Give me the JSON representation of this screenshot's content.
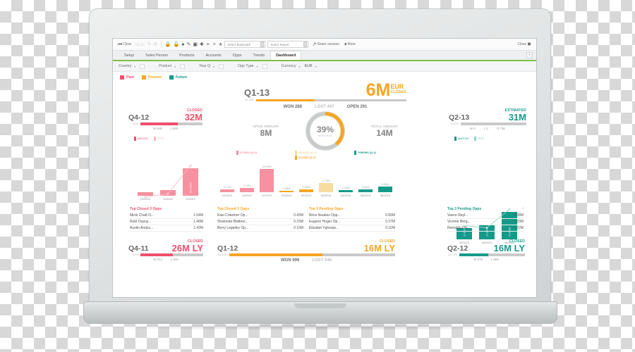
{
  "toolbar": {
    "clear_label": "Clear",
    "back_icon": "back-to-start-icon",
    "prev_icon": "previous-icon",
    "next_icon": "next-icon",
    "undo_icon": "undo-icon",
    "redo_icon": "redo-icon",
    "lock_icon": "lock-icon",
    "unlock_icon": "unlock-icon",
    "clock_icon": "clock-icon",
    "edit_icon": "edit-icon",
    "layout_icon": "layout-icon",
    "add_icon": "add-icon",
    "brush_icon": "brush-icon",
    "star_outline_icon": "star-outline-icon",
    "star_filled_icon": "star-filled-icon",
    "bookmark_field": "Select Bookmark",
    "report_field": "Select Report",
    "share_label": "Share session",
    "share_icon": "share-icon",
    "more_label": "More",
    "more_caret": "▾",
    "close_label": "Close",
    "close_icon": "close-icon"
  },
  "tabs": [
    {
      "label": "Dashboard",
      "active": true
    },
    {
      "label": "Trends",
      "active": false
    },
    {
      "label": "Opps",
      "active": false
    },
    {
      "label": "Accounts",
      "active": false
    },
    {
      "label": "Products",
      "active": false
    },
    {
      "label": "Sales Person",
      "active": false
    },
    {
      "label": "Setup",
      "active": false
    }
  ],
  "tab_add_label": "+",
  "filters": [
    {
      "label": "Country",
      "value": ""
    },
    {
      "label": "Product",
      "value": ""
    },
    {
      "label": "Year Q",
      "value": ""
    },
    {
      "label": "Opp Type",
      "value": ""
    },
    {
      "label": "Currency",
      "value": "EUR"
    }
  ],
  "legend": [
    {
      "label": "Past",
      "color": "#f04f6e"
    },
    {
      "label": "Present",
      "color": "#f5a623"
    },
    {
      "label": "Future",
      "color": "#159a8a"
    }
  ],
  "hero": {
    "period": "Q1-13",
    "value": "6M",
    "currency": "EUR",
    "caption": "CLOSED",
    "pct_label": "39.18%",
    "pct": 39.18,
    "won": "WON 288",
    "lost": "LOST 447",
    "open": "OPEN 291",
    "color": "#f5a623"
  },
  "gauge": {
    "pct_text": "39%",
    "pct": 39,
    "label": "WIN RATE",
    "open_label": "OPEN AMOUNT",
    "open_value": "8M",
    "total_label": "TOTAL AMOUNT",
    "total_value": "14M",
    "color": "#f5a623"
  },
  "columns": [
    {
      "id": "past",
      "color": "#f04f6e",
      "kpi": {
        "caption": "CLOSED",
        "period": "Q4-12",
        "value": "32M",
        "pct_label": "60%",
        "pct": 60,
        "won": "W 849",
        "lost": "L 560"
      },
      "mini_legend": [
        {
          "label": "AMOUNT",
          "color": "#f04f6e"
        },
        {
          "label": "OPPS",
          "color": "#f9b8c4"
        }
      ],
      "toplist": {
        "title": "Top Closed 3 Opps",
        "rows": [
          {
            "name": "Micki Chatt O...",
            "value": "1.54M"
          },
          {
            "name": "Robt Dupuy...",
            "value": "1.48M"
          },
          {
            "name": "Austin Andzu...",
            "value": "1.43M"
          }
        ]
      },
      "footer_kpi": {
        "caption": "CLOSED",
        "period": "Q4-11",
        "value": "26M LY",
        "pct_label": "52%",
        "pct": 52,
        "won": "W 914",
        "lost": "L 835"
      }
    },
    {
      "id": "present",
      "color": "#f5a623",
      "toplist": {
        "title": "Top Closed 3 Opps",
        "rows": [
          {
            "name": "Kasi Crawmer Op...",
            "value": "0.43M"
          },
          {
            "name": "Shalonda Blattner...",
            "value": "0.23M"
          },
          {
            "name": "Berry Legalley Op...",
            "value": "0.19M"
          }
        ]
      },
      "footer_kpi": {
        "caption": "CLOSED",
        "period": "Q1-12",
        "value": "16M LY",
        "pct_label": "56.04%",
        "pct": 56.04,
        "won": "WON 696",
        "lost": "LOST 546"
      }
    },
    {
      "id": "pending",
      "color": "#f5a623",
      "toplist": {
        "title": "Top 3 Pending Opps",
        "rows": [
          {
            "name": "Brice Noakes Opp...",
            "value": "0.89M"
          },
          {
            "name": "Eugene Hoger Op...",
            "value": "0.37M"
          },
          {
            "name": "Elizabet Yglesias...",
            "value": "0.32M"
          }
        ]
      }
    },
    {
      "id": "future",
      "color": "#159a8a",
      "kpi": {
        "caption": "ESTIMATED",
        "period": "Q2-13",
        "value": "31M",
        "pct_label": "0.00%",
        "pct": 0,
        "won": "W 0",
        "lost": "L 0",
        "open": "O 736"
      },
      "mini_legend": [
        {
          "label": "AMOUNT",
          "color": "#159a8a"
        },
        {
          "label": "OPPS",
          "color": "#8fd3c9"
        }
      ],
      "toplist": {
        "title": "Top 3 Pending Opps",
        "caret": "▾",
        "rows": [
          {
            "name": "Vance Rayl...",
            "value": "0.38M"
          },
          {
            "name": "Vicente Berg...",
            "value": "0.33M"
          },
          {
            "name": "Reinaldo Hin...",
            "value": "0.22M"
          }
        ]
      },
      "footer_kpi": {
        "caption": "CLOSED",
        "period": "Q2-12",
        "value": "16M LY",
        "pct_label": "43.72%",
        "pct": 43.72,
        "won": "W 675",
        "lost": "L 869"
      }
    }
  ],
  "chart_data": [
    {
      "id": "left-past-chart",
      "type": "bar",
      "title": "",
      "categories": [
        "10/2012",
        "11/2012",
        "12/2012"
      ],
      "values": [
        3.17,
        4.7,
        24.39
      ],
      "bar_labels": [
        "",
        "",
        "24.39M"
      ],
      "color": "#f7919f",
      "line_series": {
        "name": "Opps",
        "values": [
          3.0,
          5.2,
          25.5
        ],
        "color": "#f9b8c4"
      },
      "ylabel": "",
      "xlabel": "",
      "ylim": [
        0,
        26
      ]
    },
    {
      "id": "center-timeline-chart",
      "type": "bar",
      "title": "",
      "categories": [
        "10/2012",
        "11/2012",
        "12/2012",
        "01/2013",
        "02/2013",
        "03/2013",
        "04/2013",
        "05/2013",
        "06/2013"
      ],
      "values": [
        3.17,
        4.7,
        24.39,
        1.58,
        2.59,
        9.73,
        2.42,
        3.03,
        5.91
      ],
      "value_labels": [
        "3.17M",
        "4.70M",
        "24.39M",
        "1.58M",
        "2.59M",
        "9.73M",
        "2.42M",
        "3.03M",
        "5.91M"
      ],
      "bar_colors": [
        "#f7919f",
        "#f7919f",
        "#f7919f",
        "#f5a623",
        "#f5a623",
        "#f6dca0",
        "#159a8a",
        "#159a8a",
        "#159a8a"
      ],
      "legend": [
        {
          "label": "CLOSED Q4-12",
          "color": "#f7919f"
        },
        {
          "label": "PENDING Q1-13",
          "color": "#f6dca0"
        },
        {
          "label": "CLOSED Q1-13",
          "color": "#f5a623"
        },
        {
          "label": "PENDING Q2-13",
          "color": "#159a8a"
        }
      ],
      "ylabel": "",
      "xlabel": "",
      "ylim": [
        0,
        25
      ]
    },
    {
      "id": "right-future-chart",
      "type": "bar",
      "title": "",
      "categories": [
        "04/2013",
        "05/2013",
        "06/2013"
      ],
      "values": [
        2.42,
        3.03,
        5.91
      ],
      "bar_labels": [
        "2.42M",
        "3.03M",
        "5.91M"
      ],
      "color": "#159a8a",
      "line_series": {
        "name": "Opps",
        "values": [
          3.4,
          3.0,
          6.3
        ],
        "color": "#8fd3c9"
      },
      "ylabel": "",
      "xlabel": "",
      "ylim": [
        0,
        6.3
      ]
    }
  ]
}
